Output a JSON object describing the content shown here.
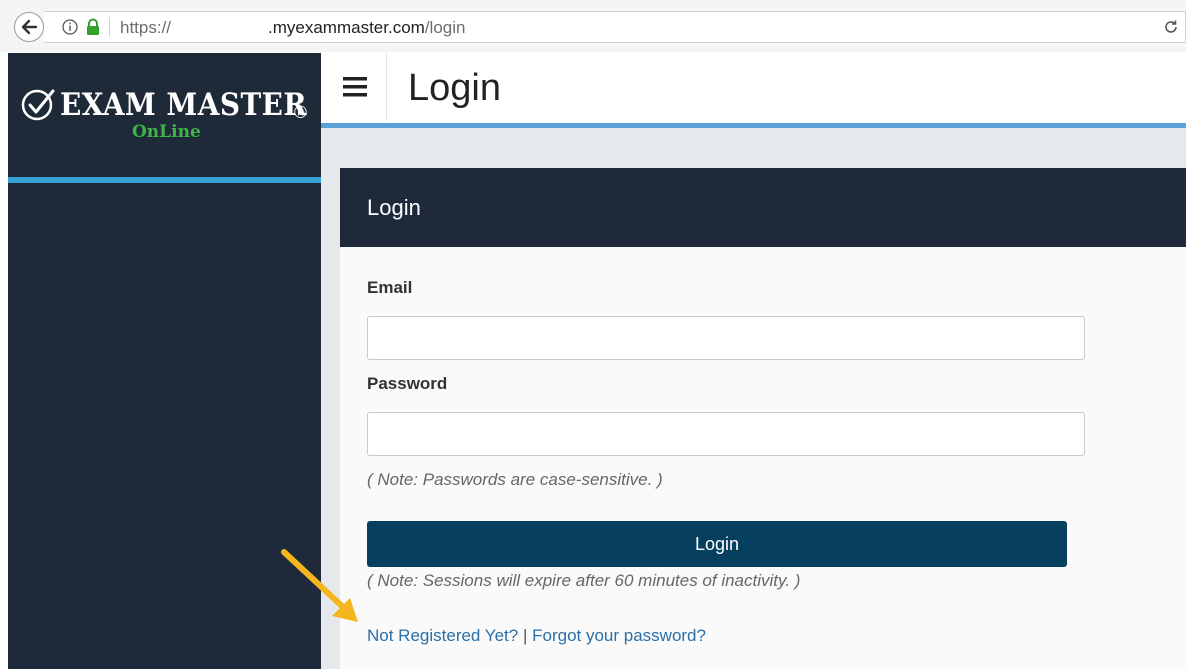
{
  "browser": {
    "url_scheme": "https://",
    "url_host": ".myexammaster.com",
    "url_path": "/login"
  },
  "logo": {
    "title": "EXAM MASTER",
    "registered_mark": "®",
    "subtitle": "OnLine"
  },
  "header": {
    "page_title": "Login"
  },
  "login_card": {
    "title": "Login",
    "email_label": "Email",
    "email_value": "",
    "password_label": "Password",
    "password_value": "",
    "password_note": "( Note: Passwords are case-sensitive. )",
    "login_button_label": "Login",
    "session_note": "( Note: Sessions will expire after 60 minutes of inactivity. )",
    "register_link": "Not Registered Yet?",
    "separator": "|",
    "forgot_link": "Forgot your password?"
  },
  "colors": {
    "sidebar_bg": "#1e2939",
    "accent_blue": "#3aa0d8",
    "button_bg": "#073f5e",
    "link": "#2a6fa8",
    "logo_green": "#3fb549",
    "annotation_arrow": "#f3b61f"
  },
  "icons": [
    "back-arrow-icon",
    "info-icon",
    "lock-icon",
    "reload-icon",
    "check-circle-icon",
    "hamburger-menu-icon",
    "annotation-arrow"
  ]
}
